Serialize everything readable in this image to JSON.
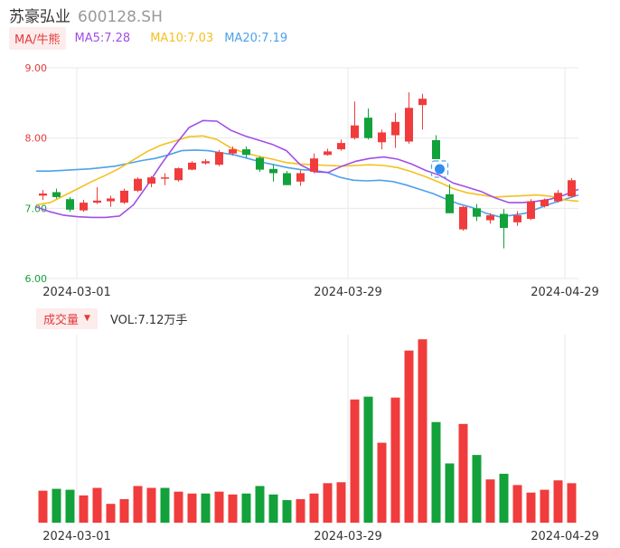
{
  "header": {
    "name": "苏豪弘业",
    "code": "600128.SH"
  },
  "ma_legend": {
    "tag": "MA/牛熊",
    "ma5": "MA5:7.28",
    "ma10": "MA10:7.03",
    "ma20": "MA20:7.19"
  },
  "volume_legend": {
    "tag": "成交量",
    "value": "VOL:7.12万手"
  },
  "colors": {
    "up": "#f03c3c",
    "down": "#12a13a",
    "ma5": "#a24ee6",
    "ma10": "#f5c020",
    "ma20": "#4ea1ea",
    "grid": "#e8e8e8"
  },
  "chart_data": [
    {
      "type": "candlestick",
      "ylim": [
        6.0,
        9.0
      ],
      "yticks": [
        "9.00",
        "8.00",
        "7.00",
        "6.00"
      ],
      "xticks": [
        {
          "index": 3,
          "label": "2024-03-01"
        },
        {
          "index": 23,
          "label": "2024-03-29"
        },
        {
          "index": 39,
          "label": "2024-04-29"
        }
      ],
      "candles": [
        {
          "o": 7.18,
          "h": 7.26,
          "l": 7.12,
          "c": 7.21
        },
        {
          "o": 7.23,
          "h": 7.28,
          "l": 7.14,
          "c": 7.16
        },
        {
          "o": 7.13,
          "h": 7.16,
          "l": 6.95,
          "c": 6.98
        },
        {
          "o": 6.97,
          "h": 7.12,
          "l": 6.95,
          "c": 7.08
        },
        {
          "o": 7.08,
          "h": 7.3,
          "l": 7.06,
          "c": 7.11
        },
        {
          "o": 7.1,
          "h": 7.18,
          "l": 7.02,
          "c": 7.14
        },
        {
          "o": 7.08,
          "h": 7.28,
          "l": 7.06,
          "c": 7.25
        },
        {
          "o": 7.25,
          "h": 7.44,
          "l": 7.23,
          "c": 7.42
        },
        {
          "o": 7.35,
          "h": 7.46,
          "l": 7.3,
          "c": 7.44
        },
        {
          "o": 7.43,
          "h": 7.5,
          "l": 7.33,
          "c": 7.44
        },
        {
          "o": 7.4,
          "h": 7.58,
          "l": 7.38,
          "c": 7.57
        },
        {
          "o": 7.55,
          "h": 7.67,
          "l": 7.54,
          "c": 7.65
        },
        {
          "o": 7.64,
          "h": 7.7,
          "l": 7.62,
          "c": 7.67
        },
        {
          "o": 7.62,
          "h": 7.83,
          "l": 7.6,
          "c": 7.8
        },
        {
          "o": 7.78,
          "h": 7.88,
          "l": 7.75,
          "c": 7.84
        },
        {
          "o": 7.84,
          "h": 7.88,
          "l": 7.72,
          "c": 7.76
        },
        {
          "o": 7.72,
          "h": 7.74,
          "l": 7.52,
          "c": 7.55
        },
        {
          "o": 7.56,
          "h": 7.62,
          "l": 7.38,
          "c": 7.5
        },
        {
          "o": 7.5,
          "h": 7.53,
          "l": 7.33,
          "c": 7.33
        },
        {
          "o": 7.38,
          "h": 7.54,
          "l": 7.32,
          "c": 7.5
        },
        {
          "o": 7.52,
          "h": 7.78,
          "l": 7.5,
          "c": 7.71
        },
        {
          "o": 7.76,
          "h": 7.85,
          "l": 7.75,
          "c": 7.81
        },
        {
          "o": 7.84,
          "h": 7.98,
          "l": 7.82,
          "c": 7.93
        },
        {
          "o": 8.0,
          "h": 8.52,
          "l": 7.98,
          "c": 8.18
        },
        {
          "o": 8.29,
          "h": 8.42,
          "l": 7.98,
          "c": 8.0
        },
        {
          "o": 7.94,
          "h": 8.12,
          "l": 7.84,
          "c": 8.08
        },
        {
          "o": 8.04,
          "h": 8.36,
          "l": 7.86,
          "c": 8.23
        },
        {
          "o": 7.95,
          "h": 8.65,
          "l": 7.92,
          "c": 8.43
        },
        {
          "o": 8.47,
          "h": 8.63,
          "l": 8.12,
          "c": 8.56
        },
        {
          "o": 7.97,
          "h": 8.04,
          "l": 7.7,
          "c": 7.7
        },
        {
          "o": 7.2,
          "h": 7.34,
          "l": 6.93,
          "c": 6.93
        },
        {
          "o": 6.7,
          "h": 7.03,
          "l": 6.68,
          "c": 7.02
        },
        {
          "o": 7.0,
          "h": 7.06,
          "l": 6.82,
          "c": 6.88
        },
        {
          "o": 6.83,
          "h": 6.93,
          "l": 6.78,
          "c": 6.9
        },
        {
          "o": 6.92,
          "h": 6.99,
          "l": 6.43,
          "c": 6.72
        },
        {
          "o": 6.8,
          "h": 6.96,
          "l": 6.75,
          "c": 6.9
        },
        {
          "o": 6.85,
          "h": 7.13,
          "l": 6.83,
          "c": 7.1
        },
        {
          "o": 7.03,
          "h": 7.14,
          "l": 7.01,
          "c": 7.12
        },
        {
          "o": 7.1,
          "h": 7.26,
          "l": 7.08,
          "c": 7.22
        },
        {
          "o": 7.17,
          "h": 7.43,
          "l": 7.15,
          "c": 7.4
        }
      ],
      "ma5": [
        7.02,
        6.95,
        6.9,
        6.88,
        6.87,
        6.87,
        6.89,
        7.05,
        7.33,
        7.63,
        7.9,
        8.15,
        8.25,
        8.24,
        8.11,
        8.03,
        7.97,
        7.91,
        7.82,
        7.62,
        7.52,
        7.51,
        7.6,
        7.67,
        7.71,
        7.73,
        7.7,
        7.63,
        7.54,
        7.47,
        7.36,
        7.3,
        7.24,
        7.15,
        7.08,
        7.08,
        7.1,
        7.13,
        7.19,
        7.27
      ],
      "ma10": [
        7.05,
        7.08,
        7.18,
        7.28,
        7.38,
        7.47,
        7.57,
        7.69,
        7.81,
        7.9,
        7.96,
        8.02,
        8.03,
        7.98,
        7.86,
        7.79,
        7.74,
        7.7,
        7.65,
        7.63,
        7.62,
        7.61,
        7.6,
        7.61,
        7.62,
        7.61,
        7.58,
        7.52,
        7.45,
        7.37,
        7.28,
        7.22,
        7.19,
        7.16,
        7.17,
        7.18,
        7.19,
        7.17,
        7.12,
        7.1
      ],
      "ma20": [
        7.53,
        7.53,
        7.54,
        7.55,
        7.56,
        7.58,
        7.6,
        7.64,
        7.68,
        7.71,
        7.76,
        7.82,
        7.83,
        7.82,
        7.79,
        7.76,
        7.71,
        7.66,
        7.62,
        7.58,
        7.55,
        7.54,
        7.51,
        7.44,
        7.4,
        7.39,
        7.4,
        7.38,
        7.33,
        7.27,
        7.21,
        7.13,
        7.06,
        7.01,
        6.93,
        6.88,
        6.9,
        6.93,
        7.0,
        7.07,
        7.13,
        7.19
      ]
    },
    {
      "type": "bar",
      "name": "成交量",
      "xticks": [
        {
          "index": 3,
          "label": "2024-03-01"
        },
        {
          "index": 23,
          "label": "2024-03-29"
        },
        {
          "index": 39,
          "label": "2024-04-29"
        }
      ],
      "values": [
        0.17,
        0.18,
        0.175,
        0.145,
        0.185,
        0.1,
        0.125,
        0.195,
        0.185,
        0.185,
        0.165,
        0.155,
        0.155,
        0.165,
        0.15,
        0.155,
        0.195,
        0.15,
        0.12,
        0.125,
        0.155,
        0.21,
        0.215,
        0.655,
        0.67,
        0.425,
        0.665,
        0.915,
        0.975,
        0.535,
        0.315,
        0.525,
        0.36,
        0.23,
        0.26,
        0.2,
        0.16,
        0.175,
        0.225,
        0.21
      ],
      "up": [
        true,
        false,
        false,
        true,
        true,
        true,
        true,
        true,
        true,
        false,
        true,
        true,
        false,
        true,
        true,
        false,
        false,
        false,
        false,
        true,
        true,
        true,
        true,
        true,
        false,
        true,
        true,
        true,
        true,
        false,
        false,
        true,
        false,
        true,
        false,
        true,
        true,
        true,
        true,
        true
      ]
    }
  ]
}
